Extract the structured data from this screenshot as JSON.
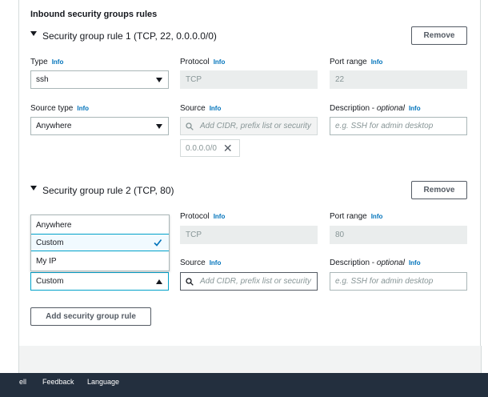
{
  "panel": {
    "title": "Inbound security groups rules"
  },
  "rule1": {
    "header": "Security group rule 1 (TCP, 22, 0.0.0.0/0)",
    "remove_label": "Remove",
    "type_label": "Type",
    "type_value": "ssh",
    "protocol_label": "Protocol",
    "protocol_value": "TCP",
    "port_label": "Port range",
    "port_value": "22",
    "source_type_label": "Source type",
    "source_type_value": "Anywhere",
    "source_label": "Source",
    "source_placeholder": "Add CIDR, prefix list or security",
    "source_token": "0.0.0.0/0",
    "desc_label": "Description - ",
    "desc_optional": "optional",
    "desc_placeholder": "e.g. SSH for admin desktop"
  },
  "rule2": {
    "header": "Security group rule 2 (TCP, 80)",
    "remove_label": "Remove",
    "protocol_label": "Protocol",
    "protocol_value": "TCP",
    "port_label": "Port range",
    "port_value": "80",
    "source_type_value": "Custom",
    "source_label": "Source",
    "source_placeholder": "Add CIDR, prefix list or security",
    "desc_label": "Description - ",
    "desc_optional": "optional",
    "desc_placeholder": "e.g. SSH for admin desktop"
  },
  "info_label": "Info",
  "dropdown": {
    "options": [
      "Anywhere",
      "Custom",
      "My IP"
    ],
    "selected": "Custom"
  },
  "add_rule_label": "Add security group rule",
  "bottombar": {
    "items": [
      "ell",
      "Feedback",
      "Language"
    ]
  },
  "colors": {
    "link": "#0073bb",
    "bottombar": "#232f3e",
    "selected_border": "#00a1c9"
  }
}
